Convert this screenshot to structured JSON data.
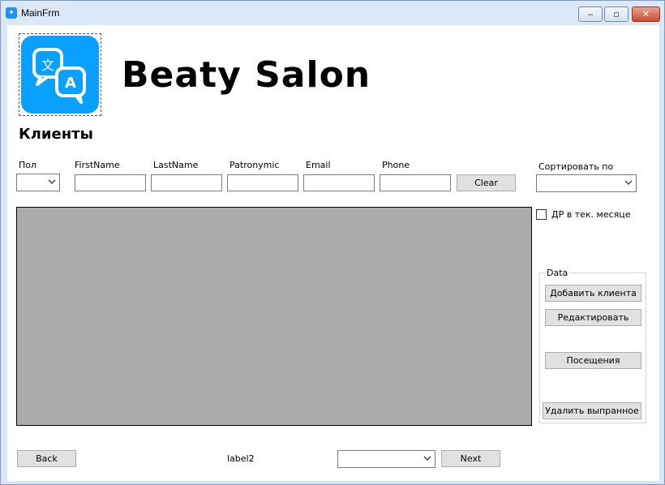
{
  "window": {
    "title": "MainFrm"
  },
  "header": {
    "app_title": "Beaty Salon",
    "section_title": "Клиенты"
  },
  "filters": {
    "gender_label": "Пол",
    "firstname_label": "FirstName",
    "lastname_label": "LastName",
    "patronymic_label": "Patronymic",
    "email_label": "Email",
    "phone_label": "Phone",
    "clear_button": "Clear",
    "sort_label": "Сортировать по",
    "birthday_checkbox_label": "ДР в тек. месяце",
    "birthday_checked": false
  },
  "data_group": {
    "legend": "Data",
    "add_button": "Добавить клиента",
    "edit_button": "Редактировать",
    "visits_button": "Посещения",
    "delete_button": "Удалить выпранное"
  },
  "pager": {
    "back_button": "Back",
    "status_label": "label2",
    "next_button": "Next"
  },
  "icons": {
    "app": "translate-icon"
  },
  "colors": {
    "logo": "#0aa0ff",
    "grid": "#ababab"
  }
}
